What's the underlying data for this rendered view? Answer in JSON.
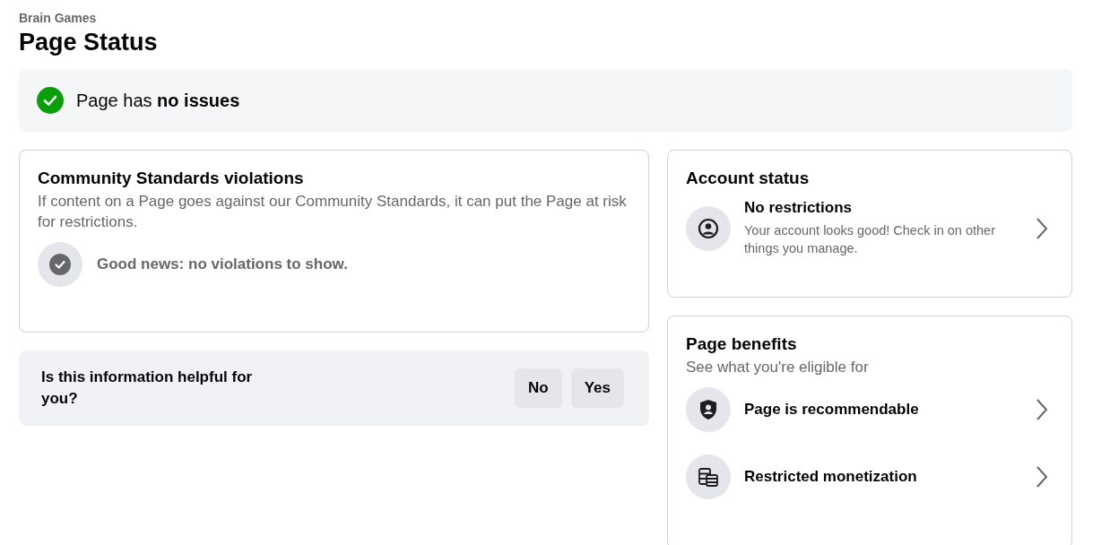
{
  "page": {
    "subtitle": "Brain Games",
    "title": "Page Status"
  },
  "status_banner": {
    "text": "Page has **no issues**",
    "ok": true
  },
  "violations": {
    "title": "Community Standards violations",
    "description": "If content on a Page goes against our Community Standards, it can put the Page at risk for restrictions.",
    "message": "Good news: no violations to show."
  },
  "feedback": {
    "question": "Is this information helpful for you?",
    "buttons": [
      "No",
      "Yes"
    ]
  },
  "account_status": {
    "title": "Account status",
    "item": {
      "kind": "person",
      "title": "No restrictions",
      "description": "Your account looks good! Check in on other things you manage."
    }
  },
  "page_benefits": {
    "title": "Page benefits",
    "subtitle": "See what you're eligible for",
    "items": [
      {
        "kind": "shield",
        "title": "Page is recommendable"
      },
      {
        "kind": "coins",
        "title": "Restricted monetization"
      }
    ]
  }
}
